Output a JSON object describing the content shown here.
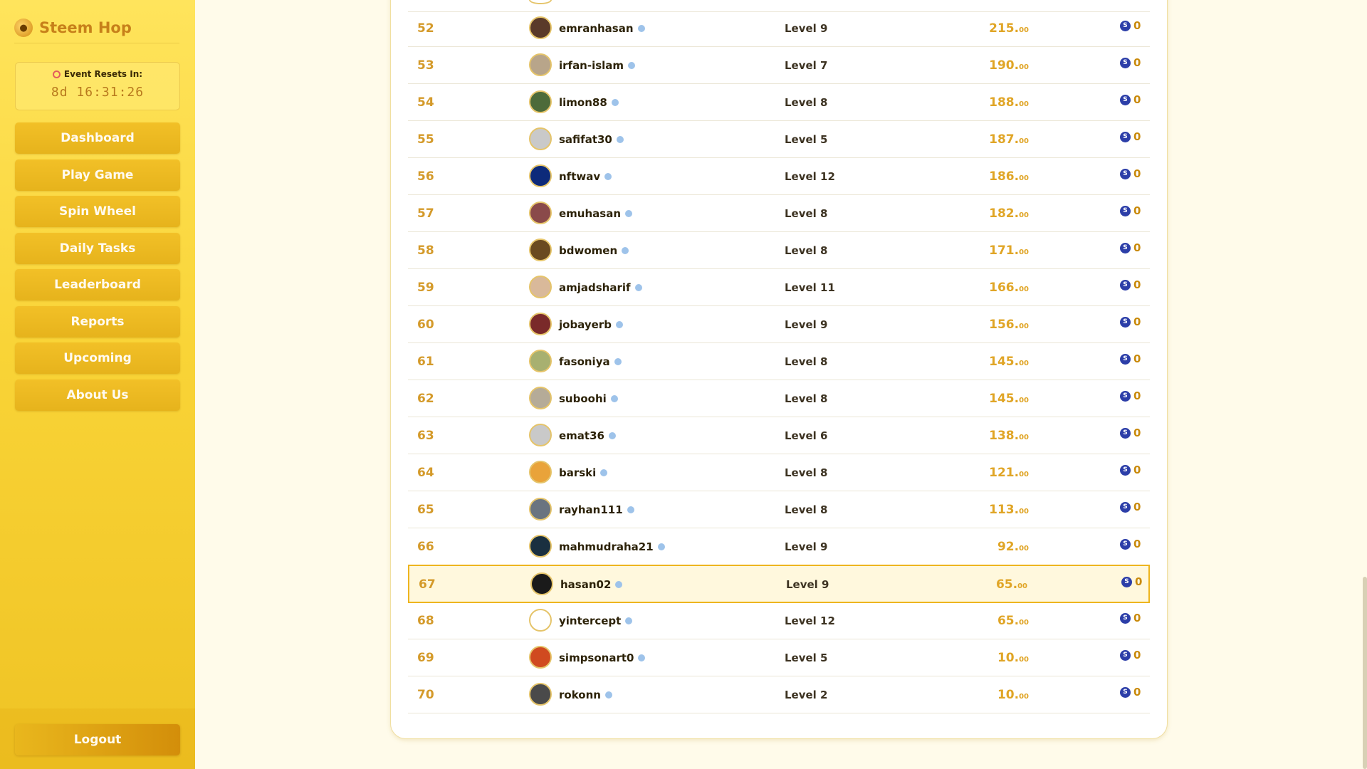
{
  "app": {
    "name": "Steem Hop",
    "logo_icon": "bee-logo-icon"
  },
  "timer": {
    "label": "Event Resets In:",
    "value": "8d 16:31:26"
  },
  "nav": [
    {
      "label": "Dashboard"
    },
    {
      "label": "Play Game"
    },
    {
      "label": "Spin Wheel"
    },
    {
      "label": "Daily Tasks"
    },
    {
      "label": "Leaderboard"
    },
    {
      "label": "Reports"
    },
    {
      "label": "Upcoming"
    },
    {
      "label": "About Us"
    }
  ],
  "logout_label": "Logout",
  "leaderboard": {
    "highlight_rank": "67",
    "rows": [
      {
        "rank": "52",
        "user": "emranhasan",
        "level": "Level 9",
        "score": "215.",
        "decimals": "00",
        "reward": "0",
        "avatar_color": "#5a3a2a"
      },
      {
        "rank": "53",
        "user": "irfan-islam",
        "level": "Level 7",
        "score": "190.",
        "decimals": "00",
        "reward": "0",
        "avatar_color": "#b8a58a"
      },
      {
        "rank": "54",
        "user": "limon88",
        "level": "Level 8",
        "score": "188.",
        "decimals": "00",
        "reward": "0",
        "avatar_color": "#4d6b3a"
      },
      {
        "rank": "55",
        "user": "safifat30",
        "level": "Level 5",
        "score": "187.",
        "decimals": "00",
        "reward": "0",
        "avatar_color": "#c9c9c9"
      },
      {
        "rank": "56",
        "user": "nftwav",
        "level": "Level 12",
        "score": "186.",
        "decimals": "00",
        "reward": "0",
        "avatar_color": "#0d2a7a"
      },
      {
        "rank": "57",
        "user": "emuhasan",
        "level": "Level 8",
        "score": "182.",
        "decimals": "00",
        "reward": "0",
        "avatar_color": "#8a4a4a"
      },
      {
        "rank": "58",
        "user": "bdwomen",
        "level": "Level 8",
        "score": "171.",
        "decimals": "00",
        "reward": "0",
        "avatar_color": "#6a4a20"
      },
      {
        "rank": "59",
        "user": "amjadsharif",
        "level": "Level 11",
        "score": "166.",
        "decimals": "00",
        "reward": "0",
        "avatar_color": "#d9b99a"
      },
      {
        "rank": "60",
        "user": "jobayerb",
        "level": "Level 9",
        "score": "156.",
        "decimals": "00",
        "reward": "0",
        "avatar_color": "#7a2a2a"
      },
      {
        "rank": "61",
        "user": "fasoniya",
        "level": "Level 8",
        "score": "145.",
        "decimals": "00",
        "reward": "0",
        "avatar_color": "#a8b070"
      },
      {
        "rank": "62",
        "user": "suboohi",
        "level": "Level 8",
        "score": "145.",
        "decimals": "00",
        "reward": "0",
        "avatar_color": "#b5ab98"
      },
      {
        "rank": "63",
        "user": "emat36",
        "level": "Level 6",
        "score": "138.",
        "decimals": "00",
        "reward": "0",
        "avatar_color": "#c9c9c9"
      },
      {
        "rank": "64",
        "user": "barski",
        "level": "Level 8",
        "score": "121.",
        "decimals": "00",
        "reward": "0",
        "avatar_color": "#e9a33a"
      },
      {
        "rank": "65",
        "user": "rayhan111",
        "level": "Level 8",
        "score": "113.",
        "decimals": "00",
        "reward": "0",
        "avatar_color": "#6a7480"
      },
      {
        "rank": "66",
        "user": "mahmudraha21",
        "level": "Level 9",
        "score": "92.",
        "decimals": "00",
        "reward": "0",
        "avatar_color": "#1a3040"
      },
      {
        "rank": "67",
        "user": "hasan02",
        "level": "Level 9",
        "score": "65.",
        "decimals": "00",
        "reward": "0",
        "avatar_color": "#1a1a1a"
      },
      {
        "rank": "68",
        "user": "yintercept",
        "level": "Level 12",
        "score": "65.",
        "decimals": "00",
        "reward": "0",
        "avatar_color": "#ffffff"
      },
      {
        "rank": "69",
        "user": "simpsonart0",
        "level": "Level 5",
        "score": "10.",
        "decimals": "00",
        "reward": "0",
        "avatar_color": "#d04a20"
      },
      {
        "rank": "70",
        "user": "rokonn",
        "level": "Level 2",
        "score": "10.",
        "decimals": "00",
        "reward": "0",
        "avatar_color": "#4a4a4a"
      }
    ]
  },
  "colors": {
    "accent": "#f2c027",
    "rank": "#d49a2a",
    "score": "#e0a526",
    "steem": "#2c3ea8"
  }
}
